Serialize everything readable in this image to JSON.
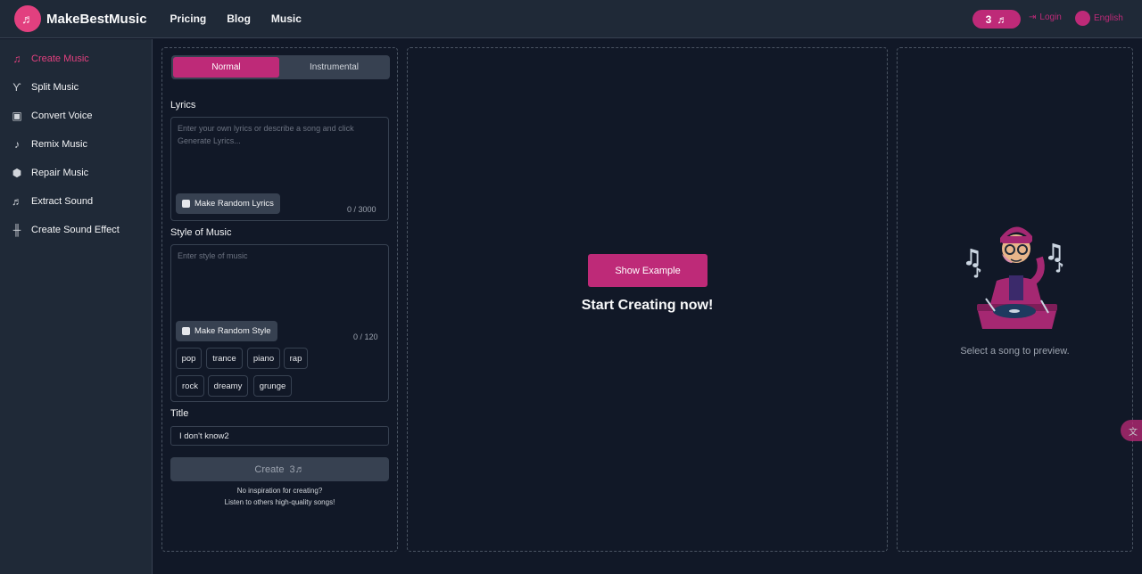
{
  "brand": {
    "name": "MakeBestMusic",
    "logo_icon": "music-note"
  },
  "nav": [
    {
      "label": "Pricing"
    },
    {
      "label": "Blog"
    },
    {
      "label": "Music"
    }
  ],
  "header": {
    "credits": "3",
    "login_label": "Login",
    "language_label": "English",
    "accent_color": "#be2a78"
  },
  "sidebar": {
    "items": [
      {
        "label": "Create Music",
        "icon": "music-note-icon",
        "active": true
      },
      {
        "label": "Split Music",
        "icon": "split-icon"
      },
      {
        "label": "Convert Voice",
        "icon": "voice-icon"
      },
      {
        "label": "Remix Music",
        "icon": "remix-icon"
      },
      {
        "label": "Repair Music",
        "icon": "cube-icon"
      },
      {
        "label": "Extract Sound",
        "icon": "extract-icon"
      },
      {
        "label": "Create Sound Effect",
        "icon": "waveform-icon"
      }
    ]
  },
  "form": {
    "mode_normal": "Normal",
    "mode_instrumental": "Instrumental",
    "lyrics_label": "Lyrics",
    "lyrics_placeholder": "Enter your own lyrics or describe a song and click Generate Lyrics...",
    "lyrics_button": "Make Random Lyrics",
    "lyrics_counter": "0 / 3000",
    "style_label": "Style of Music",
    "style_placeholder": "Enter style of music",
    "style_button": "Make Random Style",
    "style_counter": "0 / 120",
    "tags": [
      "pop",
      "trance",
      "piano",
      "rap",
      "rock",
      "dreamy",
      "grunge"
    ],
    "title_label": "Title",
    "title_value": "I don't know2",
    "create_label": "Create",
    "create_cost": "3",
    "hint_line1": "No inspiration for creating?",
    "hint_line2": "Listen to others high-quality songs!"
  },
  "main": {
    "show_example": "Show Example",
    "start_text": "Start Creating now!"
  },
  "preview": {
    "empty_text": "Select a song to preview."
  }
}
